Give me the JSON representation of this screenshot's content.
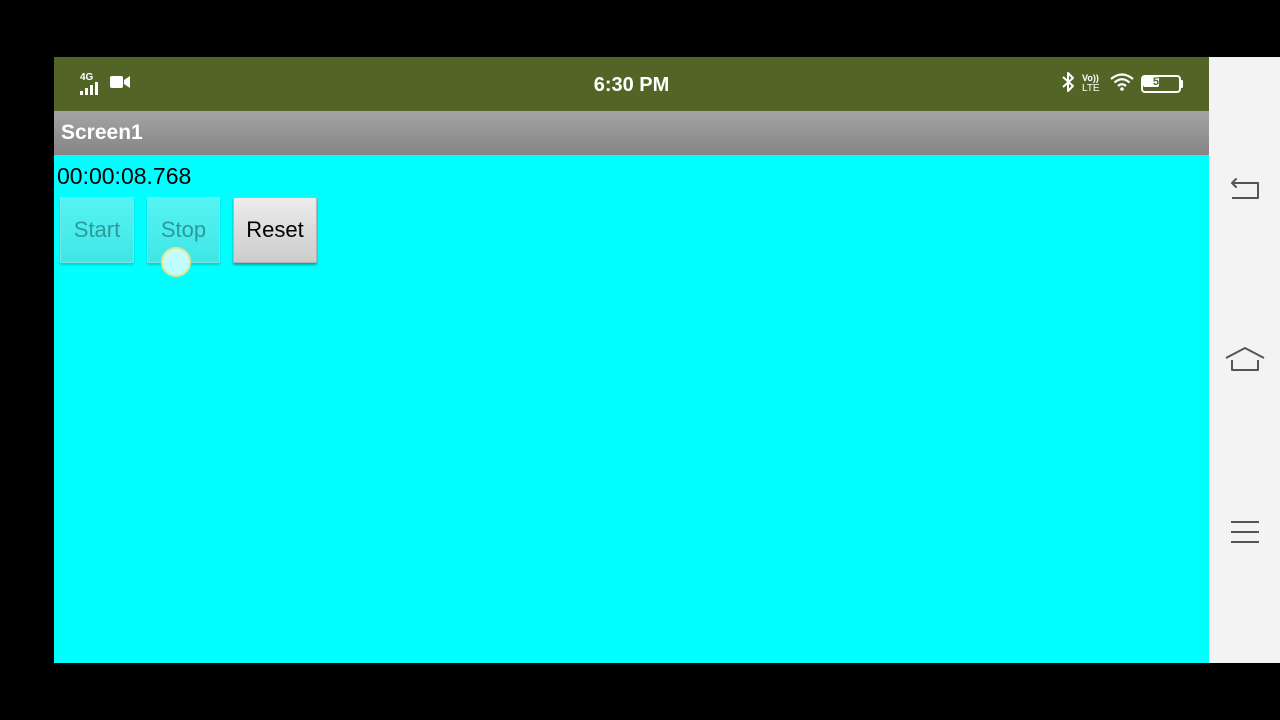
{
  "status_bar": {
    "network_label": "4G",
    "time": "6:30 PM",
    "volte_top": "Vo))",
    "volte_bottom": "LTE",
    "battery_level": "51",
    "background_color": "#536526"
  },
  "app": {
    "title": "Screen1",
    "timer_display": "00:00:08.768",
    "buttons": {
      "start": "Start",
      "stop": "Stop",
      "reset": "Reset"
    },
    "content_background": "#00ffff"
  },
  "nav": {
    "back_icon": "back-arrow-icon",
    "home_icon": "home-icon",
    "menu_icon": "menu-icon"
  }
}
